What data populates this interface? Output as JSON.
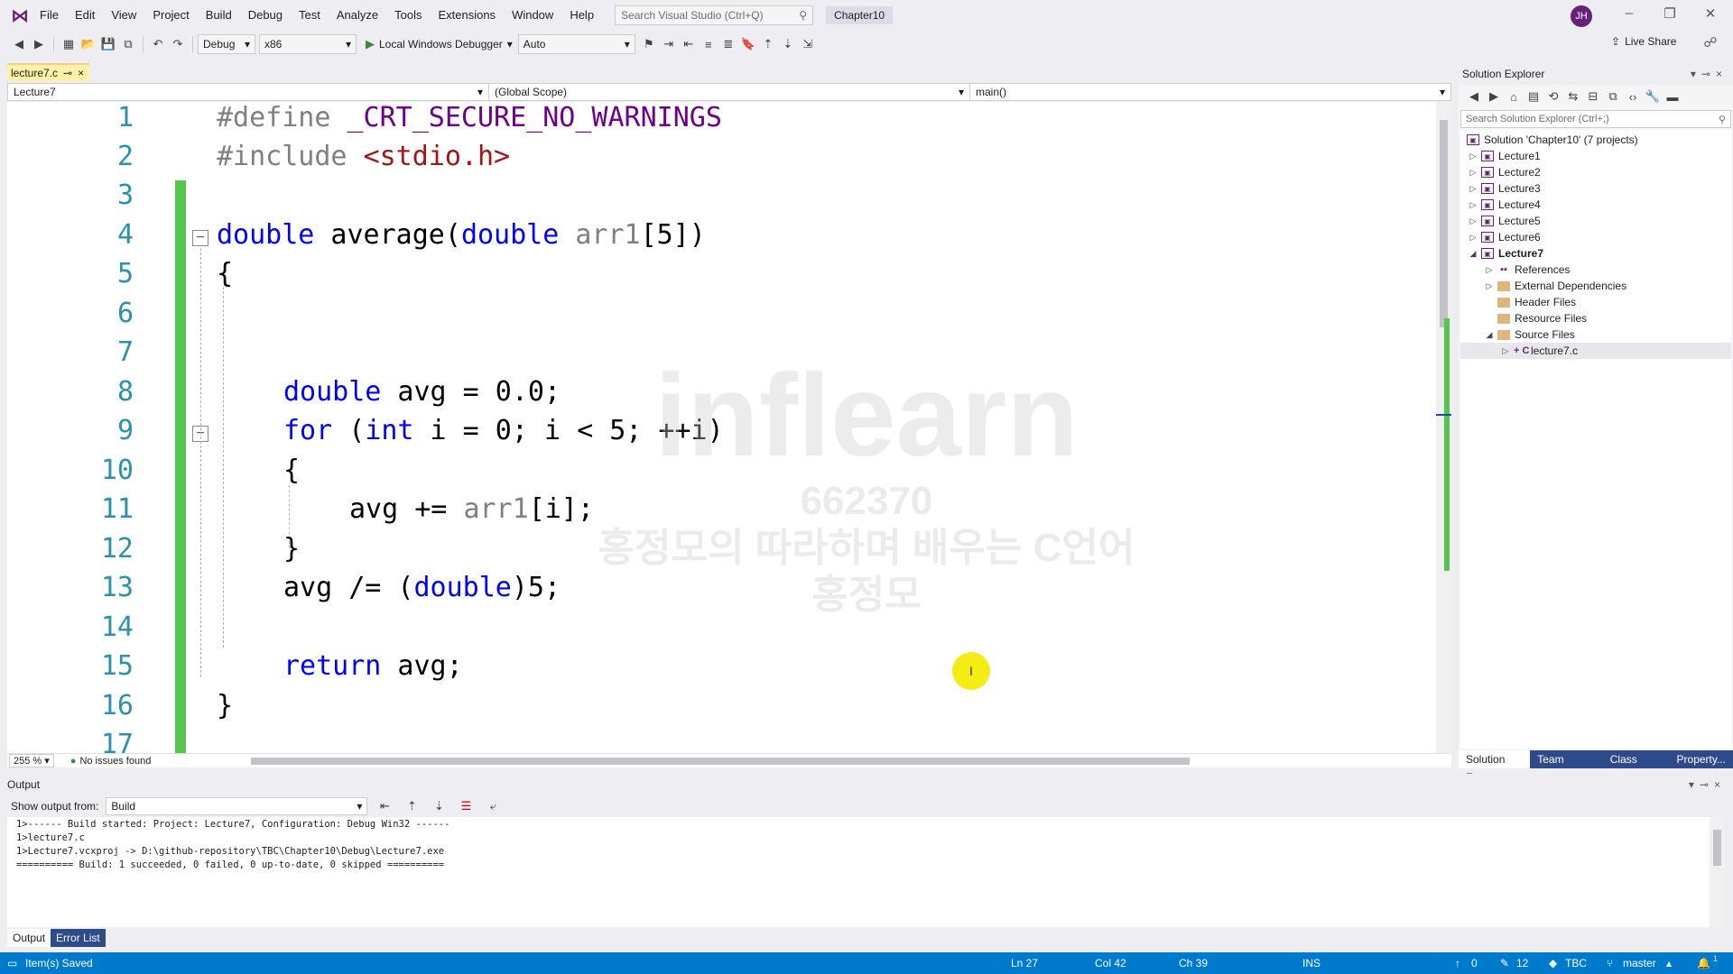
{
  "menu": {
    "items": [
      "File",
      "Edit",
      "View",
      "Project",
      "Build",
      "Debug",
      "Test",
      "Analyze",
      "Tools",
      "Extensions",
      "Window",
      "Help"
    ],
    "search_placeholder": "Search Visual Studio (Ctrl+Q)",
    "solution_name": "Chapter10",
    "avatar_initials": "JH"
  },
  "toolbar": {
    "config": "Debug",
    "platform": "x86",
    "debugger": "Local Windows Debugger",
    "auto": "Auto",
    "live_share": "Live Share"
  },
  "editor": {
    "tab_label": "lecture7.c",
    "tab_pin": "⊸",
    "tab_close": "×",
    "nav_project": "Lecture7",
    "nav_scope": "(Global Scope)",
    "nav_member": "main()",
    "zoom": "255 %",
    "issues": "No issues found",
    "line_numbers": [
      "1",
      "2",
      "3",
      "4",
      "5",
      "6",
      "7",
      "8",
      "9",
      "10",
      "11",
      "12",
      "13",
      "14",
      "15",
      "16",
      "17"
    ]
  },
  "solution_explorer": {
    "title": "Solution Explorer",
    "search_placeholder": "Search Solution Explorer (Ctrl+;)",
    "solution_label": "Solution 'Chapter10' (7 projects)",
    "projects": [
      "Lecture1",
      "Lecture2",
      "Lecture3",
      "Lecture4",
      "Lecture5",
      "Lecture6",
      "Lecture7"
    ],
    "children": [
      "References",
      "External Dependencies",
      "Header Files",
      "Resource Files",
      "Source Files"
    ],
    "file": "lecture7.c",
    "tabs": [
      "Solution E...",
      "Team Expl...",
      "Class View",
      "Property..."
    ]
  },
  "output": {
    "title": "Output",
    "show_from_label": "Show output from:",
    "source": "Build",
    "lines": [
      "1>------ Build started: Project: Lecture7, Configuration: Debug Win32 ------",
      "1>lecture7.c",
      "1>Lecture7.vcxproj -> D:\\github-repository\\TBC\\Chapter10\\Debug\\Lecture7.exe",
      "========== Build: 1 succeeded, 0 failed, 0 up-to-date, 0 skipped =========="
    ],
    "tabs": [
      "Output",
      "Error List"
    ]
  },
  "statusbar": {
    "message": "Item(s) Saved",
    "ln": "Ln 27",
    "col": "Col 42",
    "ch": "Ch 39",
    "mode": "INS",
    "up": "0",
    "edits": "12",
    "repo": "TBC",
    "branch": "master",
    "notifications": "1"
  },
  "watermark": {
    "brand": "inflearn",
    "id": "662370",
    "course": "홍정모의 따라하며 배우는 C언어",
    "author": "홍정모"
  },
  "colors": {
    "accent": "#007acc",
    "vs_purple": "#68217a",
    "change_bar": "#57c44d",
    "tab_active": "#fff1a8"
  }
}
